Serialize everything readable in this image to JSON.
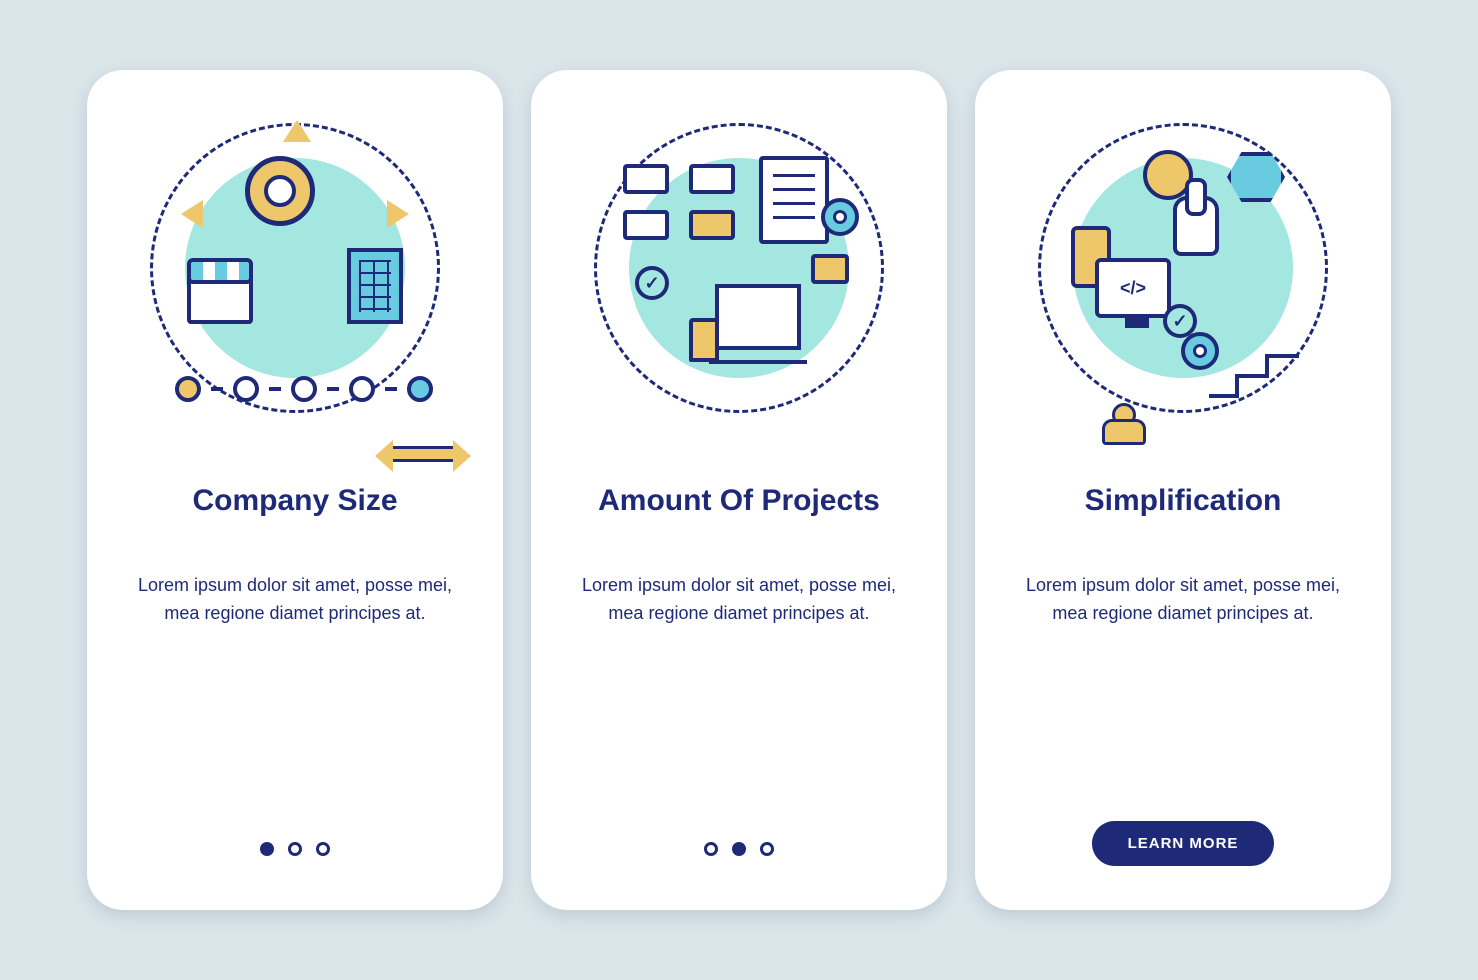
{
  "colors": {
    "background": "#dbe6eb",
    "card": "#ffffff",
    "primary": "#1e2a78",
    "accent_yellow": "#eec76b",
    "accent_blue": "#69cbe0",
    "accent_mint": "#a4e6e0"
  },
  "cards": [
    {
      "title": "Company Size",
      "description": "Lorem ipsum dolor sit amet, posse mei, mea regione diamet principes at.",
      "icon": "company-size-icon",
      "active_dot_index": 0,
      "has_cta": false
    },
    {
      "title": "Amount Of Projects",
      "description": "Lorem ipsum dolor sit amet, posse mei, mea regione diamet principes at.",
      "icon": "projects-icon",
      "active_dot_index": 1,
      "has_cta": false
    },
    {
      "title": "Simplification",
      "description": "Lorem ipsum dolor sit amet, posse mei, mea regione diamet principes at.",
      "icon": "simplification-icon",
      "active_dot_index": null,
      "has_cta": true
    }
  ],
  "dots_count": 3,
  "cta_label": "LEARN MORE"
}
